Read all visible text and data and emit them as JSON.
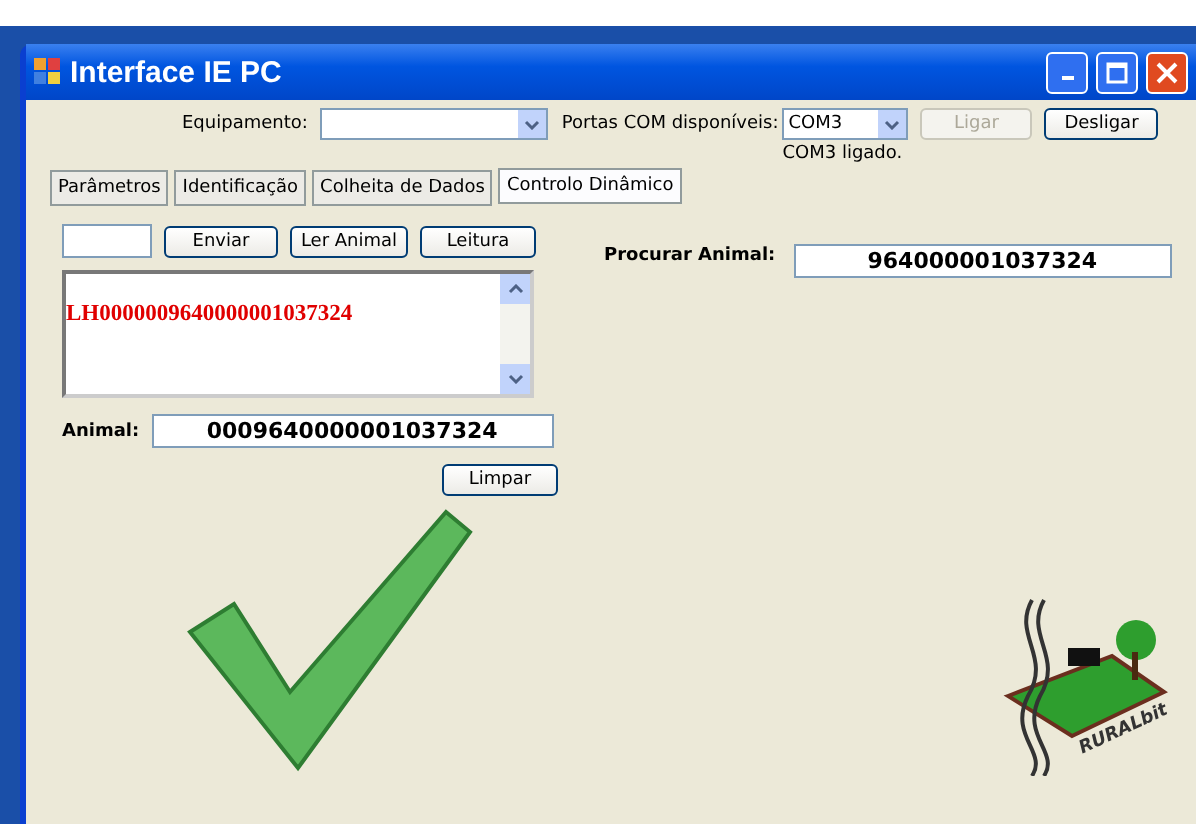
{
  "window": {
    "title": "Interface IE PC"
  },
  "equipment": {
    "label": "Equipamento:"
  },
  "ports": {
    "label": "Portas COM disponíveis:",
    "value": "COM3",
    "status": "COM3 ligado."
  },
  "connect_buttons": [
    {
      "label": "Ligar",
      "disabled": true
    },
    {
      "label": "Desligar",
      "disabled": false
    }
  ],
  "tabs": [
    {
      "label": "Parâmetros",
      "selected": false
    },
    {
      "label": "Identificação",
      "selected": false
    },
    {
      "label": "Colheita de Dados",
      "selected": false
    },
    {
      "label": "Controlo Dinâmico",
      "selected": true
    }
  ],
  "command": {
    "buttons": [
      "Enviar",
      "Ler Animal",
      "Leitura"
    ]
  },
  "log": {
    "lines": [
      "LH0000009640000001037324"
    ]
  },
  "animal": {
    "label": "Animal:",
    "value": "0009640000001037324"
  },
  "clear_button": "Limpar",
  "search": {
    "label": "Procurar Animal:",
    "value": "964000001037324"
  },
  "logo": {
    "text": "RURALbit"
  }
}
